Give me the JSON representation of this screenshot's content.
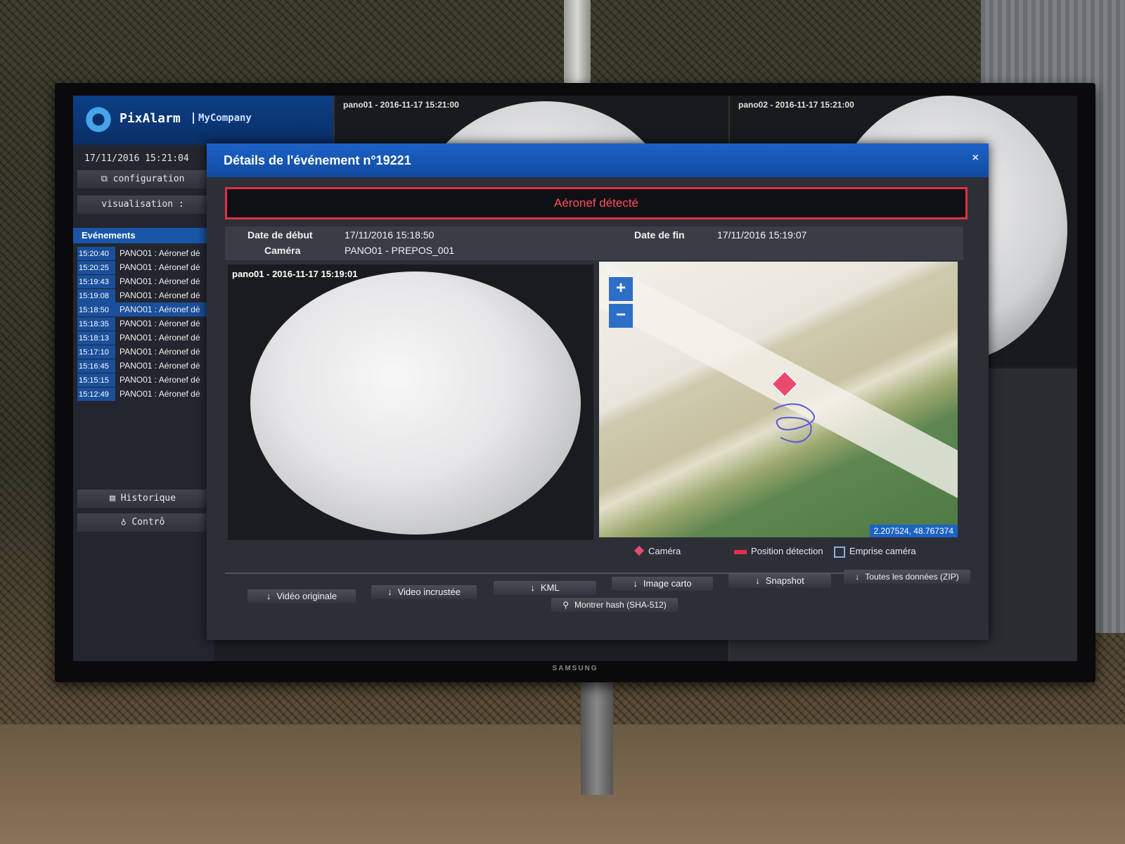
{
  "app": {
    "name": "PixAlarm",
    "company": "MyCompany",
    "clock": "17/11/2016 15:21:04",
    "tv_brand": "SAMSUNG"
  },
  "sidebar": {
    "configuration": "configuration",
    "visualisation": "visualisation :",
    "events_header": "Evénements",
    "historique": "Historique",
    "controle": "Contrô",
    "events": [
      {
        "time": "15:20:40",
        "desc": "PANO01 : Aéronef dé"
      },
      {
        "time": "15:20:25",
        "desc": "PANO01 : Aéronef dé"
      },
      {
        "time": "15:19:43",
        "desc": "PANO01 : Aéronef dé"
      },
      {
        "time": "15:19:08",
        "desc": "PANO01 : Aéronef dé"
      },
      {
        "time": "15:18:50",
        "desc": "PANO01 : Aéronef dé"
      },
      {
        "time": "15:18:35",
        "desc": "PANO01 : Aéronef dé"
      },
      {
        "time": "15:18:13",
        "desc": "PANO01 : Aéronef dé"
      },
      {
        "time": "15:17:10",
        "desc": "PANO01 : Aéronef dé"
      },
      {
        "time": "15:16:45",
        "desc": "PANO01 : Aéronef dé"
      },
      {
        "time": "15:15:15",
        "desc": "PANO01 : Aéronef dé"
      },
      {
        "time": "15:12:49",
        "desc": "PANO01 : Aéronef dé"
      }
    ]
  },
  "tiles": [
    {
      "label": "pano01 - 2016-11-17 15:21:00"
    },
    {
      "label": "pano02 - 2016-11-17 15:21:00"
    }
  ],
  "modal": {
    "title": "Détails de l'événement n°19221",
    "close": "×",
    "alert": "Aéronef détecté",
    "start_label": "Date de début",
    "start_value": "17/11/2016 15:18:50",
    "end_label": "Date de fin",
    "end_value": "17/11/2016 15:19:07",
    "camera_label": "Caméra",
    "camera_value": "PANO01 - PREPOS_001",
    "video_label": "pano01 - 2016-11-17 15:19:01",
    "map": {
      "zoom_in": "+",
      "zoom_out": "−",
      "coords": "2.207524, 48.767374"
    },
    "legend": {
      "camera": "Caméra",
      "position": "Position détection",
      "footprint": "Emprise caméra"
    },
    "buttons": {
      "video_originale": "Vidéo originale",
      "video_incrustee": "Video incrustée",
      "kml": "KML",
      "image_carto": "Image carto",
      "snapshot": "Snapshot",
      "toutes": "Toutes les données (ZIP)",
      "hash": "Montrer hash (SHA-512)"
    }
  },
  "colors": {
    "accent": "#1b62c8",
    "alert": "#e0304a",
    "marker": "#e84a6e"
  }
}
